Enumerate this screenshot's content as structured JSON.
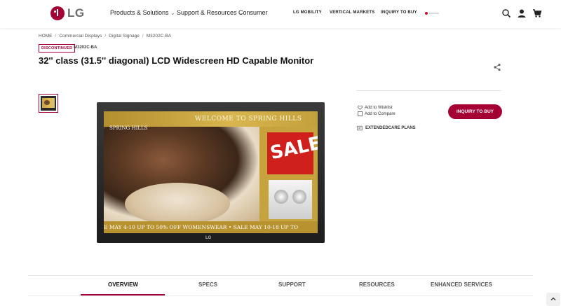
{
  "header": {
    "logo_text": "LG",
    "nav": [
      {
        "label": "Products & Solutions",
        "has_dropdown": true
      },
      {
        "label": "Support & Resources",
        "has_dropdown": true
      },
      {
        "label": "Consumer",
        "has_dropdown": false
      }
    ],
    "right_links": [
      "LG MOBILITY",
      "VERTICAL MARKETS",
      "INQUIRY TO BUY"
    ],
    "icons": [
      "search-icon",
      "account-icon",
      "cart-icon"
    ]
  },
  "breadcrumb": [
    "HOME",
    "Commercial Displays",
    "Digital Signage",
    "M3202C-BA"
  ],
  "product": {
    "status_badge": "DISCONTINUED",
    "model": "M3202C-BA",
    "title": "32'' class (31.5'' diagonal) LCD Widescreen HD Capable Monitor"
  },
  "actions": {
    "wishlist": "Add to Wishlist",
    "compare": "Add to Compare",
    "extended_care": "EXTENDEDCARE PLANS",
    "inquiry_button": "INQUIRY TO BUY"
  },
  "monitor_screen": {
    "welcome": "WELCOME TO SPRING HILLS",
    "brand": "SPRING HILLS",
    "sale_text": "SALE",
    "ticker": "E MAY 4-10 UP TO 50% OFF WOMENSWEAR • SALE MAY 10-18 UP TO",
    "bezel_logo": "LG"
  },
  "tabs": [
    {
      "label": "OVERVIEW",
      "active": true
    },
    {
      "label": "SPECS",
      "active": false
    },
    {
      "label": "SUPPORT",
      "active": false
    },
    {
      "label": "RESOURCES",
      "active": false
    },
    {
      "label": "ENHANCED SERVICES",
      "active": false
    }
  ],
  "colors": {
    "accent": "#a50034"
  }
}
